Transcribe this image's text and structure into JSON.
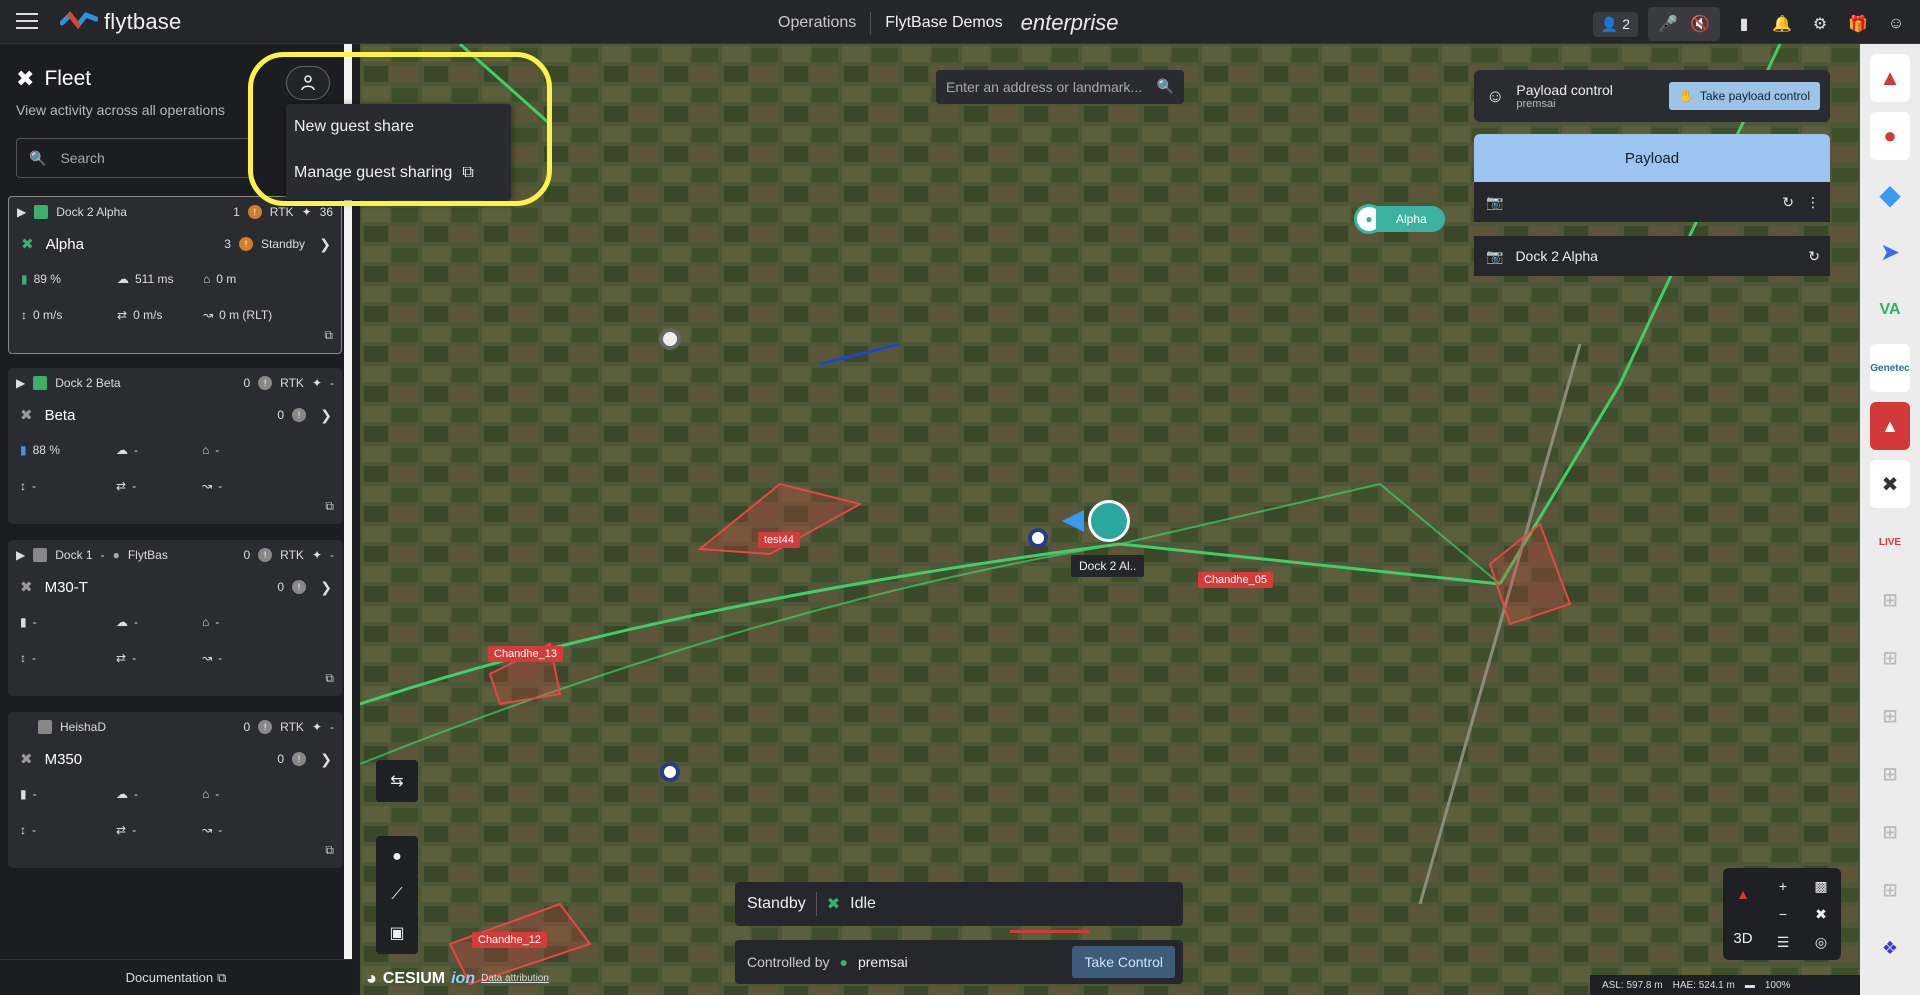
{
  "topbar": {
    "brand": "flytbase",
    "nav": "Operations",
    "org": "FlytBase Demos",
    "edition": "enterprise",
    "user_count": "2"
  },
  "sidebar": {
    "title": "Fleet",
    "subtitle": "View activity across all operations",
    "search_placeholder": "Search",
    "share_menu": [
      "New guest share",
      "Manage guest sharing"
    ],
    "documentation": "Documentation",
    "cards": [
      {
        "dock": "Dock 2 Alpha",
        "dock_count": "1",
        "rtk": "RTK",
        "sats": "36",
        "drone": "Alpha",
        "drone_count": "3",
        "state": "Standby",
        "battery": "89 %",
        "wind": "511 ms",
        "home": "0 m",
        "vspeed": "0 m/s",
        "hspeed": "0 m/s",
        "alt": "0 m (RLT)"
      },
      {
        "dock": "Dock 2 Beta",
        "dock_count": "0",
        "rtk": "RTK",
        "sats": "-",
        "drone": "Beta",
        "drone_count": "0",
        "state": "",
        "battery": "88 %",
        "wind": "-",
        "home": "-",
        "vspeed": "-",
        "hspeed": "-",
        "alt": "-"
      },
      {
        "dock": "Dock 1",
        "dock_extra": "FlytBas",
        "dock_count": "0",
        "rtk": "RTK",
        "sats": "-",
        "drone": "M30-T",
        "drone_count": "0",
        "state": "",
        "battery": "-",
        "wind": "-",
        "home": "-",
        "vspeed": "-",
        "hspeed": "-",
        "alt": "-"
      },
      {
        "dock": "HeishaD",
        "dock_count": "0",
        "rtk": "RTK",
        "sats": "-",
        "drone": "M350",
        "drone_count": "0",
        "state": "",
        "battery": "-",
        "wind": "-",
        "home": "-",
        "vspeed": "-",
        "hspeed": "-",
        "alt": "-"
      }
    ]
  },
  "map": {
    "search_placeholder": "Enter an address or landmark...",
    "labels": {
      "test44": "test44",
      "chandhe13": "Chandhe_13",
      "chandhe05": "Chandhe_05",
      "chandhe12": "Chandhe_12",
      "dock": "Dock 2 Al..",
      "alpha": "Alpha"
    },
    "cesium": "CESIUM",
    "cesium_ion": "ion",
    "attribution": "Data attribution",
    "asl": "ASL: 597.8 m",
    "hae": "HAE: 524.1 m",
    "battery": "100%",
    "view_mode": "3D"
  },
  "payload": {
    "control_label": "Payload control",
    "controller": "premsai",
    "take_button": "Take payload control",
    "tab": "Payload",
    "dock_row": "Dock 2 Alpha"
  },
  "status": {
    "state": "Standby",
    "drone_state": "Idle",
    "controlled_by_label": "Controlled by",
    "controller": "premsai",
    "take_control": "Take Control"
  },
  "rail": {
    "genetec": "Genetec",
    "live": "LIVE"
  }
}
